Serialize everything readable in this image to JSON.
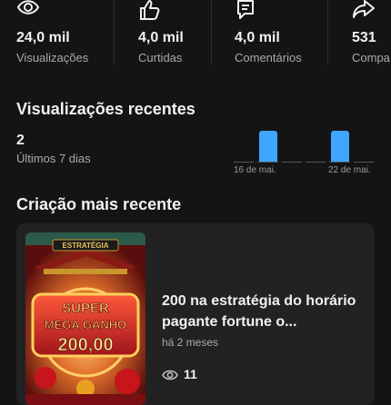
{
  "stats": [
    {
      "icon": "eye-icon",
      "value": "24,0 mil",
      "label": "Visualizações"
    },
    {
      "icon": "thumbs-up-icon",
      "value": "4,0 mil",
      "label": "Curtidas"
    },
    {
      "icon": "comment-icon",
      "value": "4,0 mil",
      "label": "Comentários"
    },
    {
      "icon": "share-icon",
      "value": "531",
      "label": "Compa"
    }
  ],
  "recent": {
    "title": "Visualizações recentes",
    "count": "2",
    "period": "Últimos 7 dias"
  },
  "chart_data": {
    "type": "bar",
    "categories": [
      "",
      "16 de mai.",
      "",
      "",
      "22 de mai.",
      ""
    ],
    "values": [
      0,
      1,
      0,
      0,
      1,
      0
    ],
    "tick_labels": [
      "16 de mai.",
      "22 de mai."
    ],
    "color": "#3ea6ff"
  },
  "latest": {
    "title": "Criação mais recente",
    "video_title": "200 na  estratégia do horário pagante fortune o...",
    "age": "há 2 meses",
    "views": "11",
    "thumbnail": {
      "banner": "ESTRATÉGIA",
      "line1": "SUPER",
      "line2": "MEGA GANHO",
      "amount": "200,00"
    }
  },
  "colors": {
    "background": "#141414",
    "card": "#222222",
    "accent": "#3ea6ff"
  }
}
